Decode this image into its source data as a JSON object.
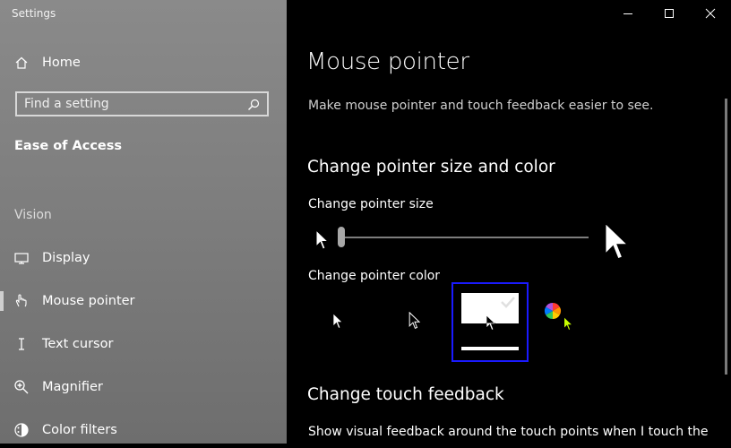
{
  "app": {
    "title": "Settings"
  },
  "sidebar": {
    "home_label": "Home",
    "search_placeholder": "Find a setting",
    "section_title": "Ease of Access",
    "group_title": "Vision",
    "items": [
      {
        "label": "Display",
        "icon": "monitor-icon"
      },
      {
        "label": "Mouse pointer",
        "icon": "hand-pointer-icon",
        "selected": true
      },
      {
        "label": "Text cursor",
        "icon": "text-cursor-icon"
      },
      {
        "label": "Magnifier",
        "icon": "magnifier-icon"
      },
      {
        "label": "Color filters",
        "icon": "color-filters-icon"
      }
    ]
  },
  "window": {
    "controls": [
      "minimize",
      "maximize",
      "close"
    ]
  },
  "main": {
    "title": "Mouse pointer",
    "description": "Make mouse pointer and touch feedback easier to see.",
    "size_color_heading": "Change pointer size and color",
    "pointer_size_label": "Change pointer size",
    "pointer_size": {
      "min": 1,
      "max": 15,
      "value": 1
    },
    "pointer_color_label": "Change pointer color",
    "pointer_color_options": [
      "white",
      "black",
      "inverted",
      "custom"
    ],
    "pointer_color_selected": "inverted",
    "touch_heading": "Change touch feedback",
    "touch_description": "Show visual feedback around the touch points when I touch the"
  },
  "colors": {
    "sidebar_bg": "#808080",
    "main_bg": "#000000",
    "selection_border": "#1a1aff",
    "custom_pointer": "#c8ff00"
  }
}
